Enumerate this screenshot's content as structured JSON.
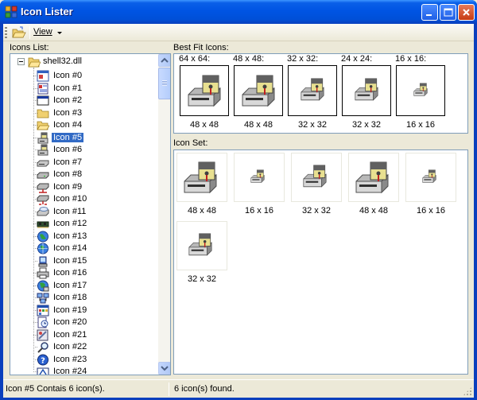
{
  "window": {
    "title": "Icon Lister"
  },
  "toolbar": {
    "view_label": "View"
  },
  "labels": {
    "icons_list": "Icons List:",
    "best_fit": "Best Fit Icons:",
    "icon_set": "Icon Set:"
  },
  "tree": {
    "root": "shell32.dll",
    "selected_index": 5,
    "items": [
      {
        "label": "Icon #0",
        "icon": "dialog-window-icon"
      },
      {
        "label": "Icon #1",
        "icon": "document-icon"
      },
      {
        "label": "Icon #2",
        "icon": "application-window-icon"
      },
      {
        "label": "Icon #3",
        "icon": "folder-icon"
      },
      {
        "label": "Icon #4",
        "icon": "folder-open-icon"
      },
      {
        "label": "Icon #5",
        "icon": "floppy-drive-icon"
      },
      {
        "label": "Icon #6",
        "icon": "floppy-drive-small-icon"
      },
      {
        "label": "Icon #7",
        "icon": "removable-drive-icon"
      },
      {
        "label": "Icon #8",
        "icon": "hard-drive-icon"
      },
      {
        "label": "Icon #9",
        "icon": "network-drive-icon"
      },
      {
        "label": "Icon #10",
        "icon": "disconnected-drive-icon"
      },
      {
        "label": "Icon #11",
        "icon": "cd-drive-icon"
      },
      {
        "label": "Icon #12",
        "icon": "memory-chip-icon"
      },
      {
        "label": "Icon #13",
        "icon": "globe-icon"
      },
      {
        "label": "Icon #14",
        "icon": "globe-network-icon"
      },
      {
        "label": "Icon #15",
        "icon": "hardware-icon"
      },
      {
        "label": "Icon #16",
        "icon": "printer-icon"
      },
      {
        "label": "Icon #17",
        "icon": "network-neighborhood-icon"
      },
      {
        "label": "Icon #18",
        "icon": "workgroup-icon"
      },
      {
        "label": "Icon #19",
        "icon": "programs-group-icon"
      },
      {
        "label": "Icon #20",
        "icon": "recent-documents-icon"
      },
      {
        "label": "Icon #21",
        "icon": "settings-icon"
      },
      {
        "label": "Icon #22",
        "icon": "find-icon"
      },
      {
        "label": "Icon #23",
        "icon": "help-icon"
      },
      {
        "label": "Icon #24",
        "icon": "run-icon"
      }
    ]
  },
  "best_fit": [
    {
      "caption": "64 x 64:",
      "dimension": "48 x 48",
      "size": "large"
    },
    {
      "caption": "48 x 48:",
      "dimension": "48 x 48",
      "size": "large"
    },
    {
      "caption": "32 x 32:",
      "dimension": "32 x 32",
      "size": "medium"
    },
    {
      "caption": "24 x 24:",
      "dimension": "32 x 32",
      "size": "medium"
    },
    {
      "caption": "16 x 16:",
      "dimension": "16 x 16",
      "size": "small"
    }
  ],
  "icon_set": [
    {
      "dimension": "48 x 48",
      "size": "large"
    },
    {
      "dimension": "16 x 16",
      "size": "small"
    },
    {
      "dimension": "32 x 32",
      "size": "medium"
    },
    {
      "dimension": "48 x 48",
      "size": "large"
    },
    {
      "dimension": "16 x 16",
      "size": "small"
    },
    {
      "dimension": "32 x 32",
      "size": "medium"
    }
  ],
  "status": {
    "left": "Icon #5 Contais 6 icon(s).",
    "right": "6 icon(s) found."
  }
}
